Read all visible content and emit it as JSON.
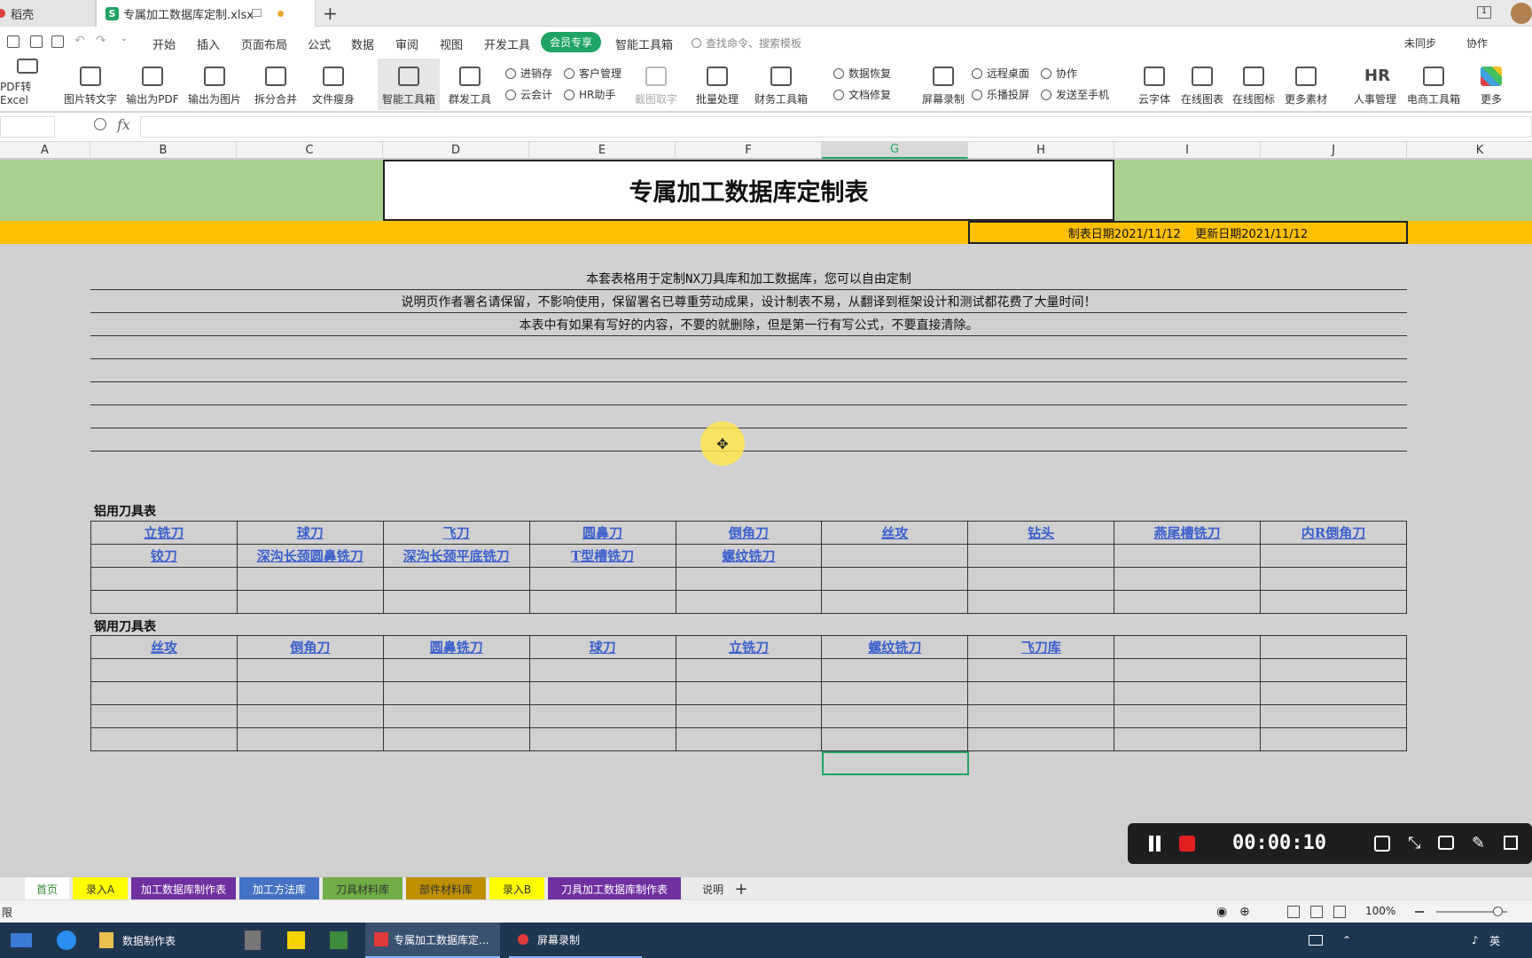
{
  "tabs": {
    "tab1": "稻壳",
    "tab2": "专属加工数据库定制.xlsx",
    "new_tab": "+"
  },
  "menu": {
    "items": [
      "开始",
      "插入",
      "页面布局",
      "公式",
      "数据",
      "审阅",
      "视图",
      "开发工具",
      "会员专享",
      "智能工具箱"
    ],
    "search_placeholder": "查找命令、搜索模板",
    "right": [
      "未同步",
      "协作"
    ]
  },
  "ribbon": {
    "big": [
      "PDF转Excel",
      "图片转文字",
      "输出为PDF",
      "输出为图片",
      "拆分合并",
      "文件瘦身",
      "智能工具箱",
      "群发工具",
      "截图取字",
      "批量处理",
      "财务工具箱",
      "屏幕录制",
      "云字体",
      "在线图表",
      "在线图标",
      "更多素材",
      "人事管理",
      "电商工具箱",
      "更多"
    ],
    "small": [
      "进销存",
      "客户管理",
      "云会计",
      "HR助手",
      "数据恢复",
      "文档修复",
      "远程桌面",
      "协作",
      "乐播投屏",
      "发送至手机"
    ]
  },
  "formula": {
    "fx": "fx"
  },
  "columns": [
    "A",
    "B",
    "C",
    "D",
    "E",
    "F",
    "G",
    "H",
    "I",
    "J",
    "K"
  ],
  "sheet": {
    "title": "专属加工数据库定制表",
    "dates": "制表日期2021/11/12    更新日期2021/11/12",
    "notes": [
      "本套表格用于定制NX刀具库和加工数据库，您可以自由定制",
      "说明页作者署名请保留，不影响使用，保留署名已尊重劳动成果，设计制表不易，从翻译到框架设计和测试都花费了大量时间！",
      "本表中有如果有写好的内容，不要的就删除，但是第一行有写公式，不要直接清除。"
    ],
    "aluminum_label": "铝用刀具表",
    "aluminum_rows": [
      [
        "立铣刀",
        "球刀",
        "飞刀",
        "圆鼻刀",
        "倒角刀",
        "丝攻",
        "钻头",
        "燕尾槽铣刀",
        "内R倒角刀"
      ],
      [
        "铰刀",
        "深沟长颈圆鼻铣刀",
        "深沟长颈平底铣刀",
        "T型槽铣刀",
        "螺纹铣刀",
        "",
        "",
        "",
        ""
      ],
      [
        "",
        "",
        "",
        "",
        "",
        "",
        "",
        "",
        ""
      ],
      [
        "",
        "",
        "",
        "",
        "",
        "",
        "",
        "",
        ""
      ]
    ],
    "steel_label": "钢用刀具表",
    "steel_rows": [
      [
        "丝攻",
        "倒角刀",
        "圆鼻铣刀",
        "球刀",
        "立铣刀",
        "螺纹铣刀",
        "飞刀库",
        "",
        ""
      ],
      [
        "",
        "",
        "",
        "",
        "",
        "",
        "",
        "",
        ""
      ],
      [
        "",
        "",
        "",
        "",
        "",
        "",
        "",
        "",
        ""
      ],
      [
        "",
        "",
        "",
        "",
        "",
        "",
        "",
        "",
        ""
      ],
      [
        "",
        "",
        "",
        "",
        "",
        "",
        "",
        "",
        ""
      ]
    ]
  },
  "recorder": {
    "time": "00:00:10"
  },
  "sheet_tabs": [
    {
      "label": "首页",
      "color": "#ffffff",
      "text": "#2e8b2e"
    },
    {
      "label": "录入A",
      "color": "#ffff00",
      "text": "#333"
    },
    {
      "label": "加工数据库制作表",
      "color": "#7030a0",
      "text": "#fff"
    },
    {
      "label": "加工方法库",
      "color": "#4472c4",
      "text": "#fff"
    },
    {
      "label": "刀具材料库",
      "color": "#70ad47",
      "text": "#333"
    },
    {
      "label": "部件材料库",
      "color": "#bf8f00",
      "text": "#333"
    },
    {
      "label": "录入B",
      "color": "#ffff00",
      "text": "#333"
    },
    {
      "label": "刀具加工数据库制作表",
      "color": "#7030a0",
      "text": "#fff"
    },
    {
      "label": "说明",
      "color": "#eaeaea",
      "text": "#333"
    }
  ],
  "status": {
    "zoom": "100%",
    "left": "限"
  },
  "taskbar": {
    "items": [
      "数据制作表",
      "专属加工数据库定...",
      "屏幕录制"
    ],
    "ime": "英"
  }
}
